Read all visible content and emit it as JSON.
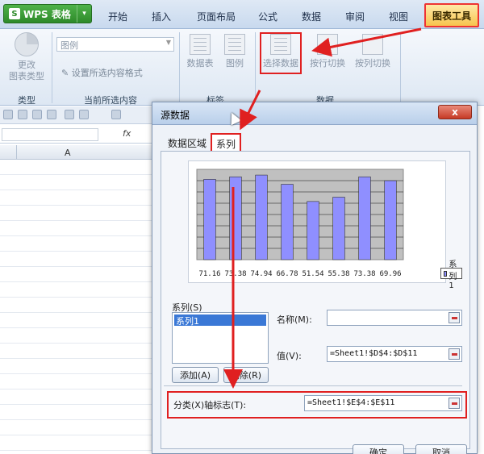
{
  "app": {
    "name": "WPS 表格",
    "logo": "S",
    "menu_caret": "▾"
  },
  "ribbon_tabs": [
    "开始",
    "插入",
    "页面布局",
    "公式",
    "数据",
    "审阅",
    "视图"
  ],
  "active_tab": "图表工具",
  "ribbon": {
    "change_type": "更改\n图表类型",
    "group_type": "类型",
    "combo_value": "图例",
    "set_format": "设置所选内容格式",
    "group_current": "当前所选内容",
    "data_table": "数据表",
    "legend": "图例",
    "group_labels": "标签",
    "select_data": "选择数据",
    "switch_row": "按行切换",
    "switch_col": "按列切换",
    "group_data": "数据"
  },
  "sheet": {
    "fx": "fx",
    "column_a": "A"
  },
  "dialog": {
    "title": "源数据",
    "close": "x",
    "tab_range": "数据区域",
    "tab_series": "系列",
    "series_label": "系列(S)",
    "series_items": [
      "系列1"
    ],
    "name_label": "名称(M):",
    "name_value": "",
    "value_label": "值(V):",
    "value_value": "=Sheet1!$D$4:$D$11",
    "add_button": "添加(A)",
    "delete_button": "删除(R)",
    "category_label": "分类(X)轴标志(T):",
    "category_value": "=Sheet1!$E$4:$E$11",
    "ok_button": "确定",
    "cancel_button": "取消"
  },
  "chart_data": {
    "type": "bar",
    "categories": [
      "71.16",
      "73.38",
      "74.94",
      "66.78",
      "51.54",
      "55.38",
      "73.38",
      "69.96"
    ],
    "series": [
      {
        "name": "系列1",
        "values": [
          71.16,
          73.38,
          74.94,
          66.78,
          51.54,
          55.38,
          73.38,
          69.96
        ]
      }
    ],
    "ylim": [
      0,
      80
    ],
    "grid": true,
    "legend": "right",
    "colors": {
      "bar": "#8f8fff",
      "plot_bg": "#c0c0c0"
    }
  },
  "colors": {
    "accent_red": "#e02020",
    "app_green": "#2e8a2a",
    "active_tab": "#f7c44e"
  }
}
